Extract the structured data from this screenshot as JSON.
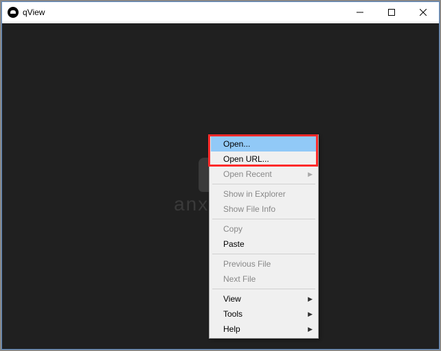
{
  "window": {
    "title": "qView"
  },
  "watermark": "anxz.com",
  "menu": {
    "open": "Open...",
    "open_url": "Open URL...",
    "open_recent": "Open Recent",
    "show_explorer": "Show in Explorer",
    "show_file_info": "Show File Info",
    "copy": "Copy",
    "paste": "Paste",
    "previous_file": "Previous File",
    "next_file": "Next File",
    "view": "View",
    "tools": "Tools",
    "help": "Help"
  }
}
